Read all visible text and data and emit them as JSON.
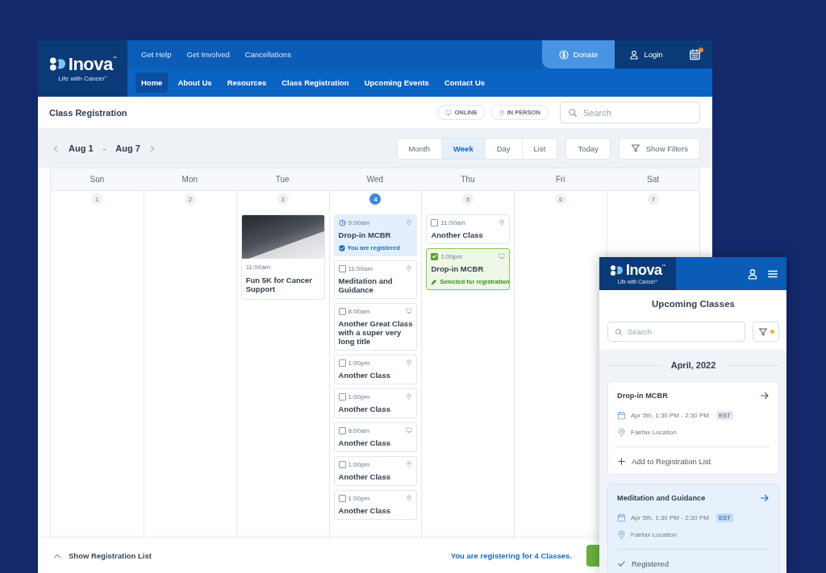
{
  "header": {
    "logo": {
      "wordmark": "Inova$^{™}$",
      "tagline": "Life with Cancer$^{®}$"
    },
    "utility_links": [
      "Get Help",
      "Get Involved",
      "Cancellations"
    ],
    "donate": "Donate",
    "login": "Login",
    "calendar_notification": true
  },
  "nav": [
    {
      "label": "Home",
      "selected": true
    },
    {
      "label": "About Us",
      "selected": false
    },
    {
      "label": "Resources",
      "selected": false
    },
    {
      "label": "Class Registration",
      "selected": false
    },
    {
      "label": "Upcoming Events",
      "selected": false
    },
    {
      "label": "Contact Us",
      "selected": false
    }
  ],
  "page_header": {
    "title": "Class Registration",
    "chips": [
      {
        "label": "ONLINE",
        "kind": "online"
      },
      {
        "label": "IN PERSON",
        "kind": "in_person"
      }
    ],
    "search": {
      "placeholder": "Search"
    }
  },
  "toolbar": {
    "range_start": "Aug 1",
    "separator": "-",
    "range_end": "Aug 7",
    "views": [
      {
        "label": "Month",
        "selected": false
      },
      {
        "label": "Week",
        "selected": true
      },
      {
        "label": "Day",
        "selected": false
      },
      {
        "label": "List",
        "selected": false
      }
    ],
    "today": "Today",
    "filters": "Show Filters"
  },
  "calendar": {
    "days": [
      {
        "name": "Sun",
        "date": "1",
        "selected": false
      },
      {
        "name": "Mon",
        "date": "2",
        "selected": false
      },
      {
        "name": "Tue",
        "date": "3",
        "selected": false,
        "events": [
          {
            "kind": "featured",
            "time": "11:00am",
            "title": "Fun 5K for Cancer Support"
          }
        ]
      },
      {
        "name": "Wed",
        "date": "4",
        "selected": true,
        "events": [
          {
            "kind": "in_person",
            "registered": true,
            "time": "9:00am",
            "title": "Drop-in MCBR",
            "note": "You are registered"
          },
          {
            "kind": "in_person",
            "registered": false,
            "checked": false,
            "time": "11:00am",
            "title": "Meditation and Guidance"
          },
          {
            "kind": "online",
            "registered": false,
            "checked": false,
            "time": "8:00am",
            "title": "Another Great Class with a super very long title"
          },
          {
            "kind": "in_person",
            "registered": false,
            "checked": false,
            "time": "1:00pm",
            "title": "Another Class"
          },
          {
            "kind": "in_person",
            "registered": false,
            "checked": false,
            "time": "1:00pm",
            "title": "Another Class"
          },
          {
            "kind": "online",
            "registered": false,
            "checked": false,
            "time": "8:00am",
            "title": "Another Class"
          },
          {
            "kind": "in_person",
            "registered": false,
            "checked": false,
            "time": "1:00pm",
            "title": "Another Class"
          },
          {
            "kind": "in_person",
            "registered": false,
            "checked": false,
            "time": "1:00pm",
            "title": "Another Class"
          }
        ]
      },
      {
        "name": "Thu",
        "date": "5",
        "selected": false,
        "events": [
          {
            "kind": "in_person",
            "registered": false,
            "checked": false,
            "time": "11:00am",
            "title": "Another Class"
          },
          {
            "kind": "online",
            "registered": false,
            "checked": true,
            "time": "1:00pm",
            "title": "Drop-in MCBR",
            "note": "Selected for registration"
          }
        ]
      },
      {
        "name": "Fri",
        "date": "6",
        "selected": false
      },
      {
        "name": "Sat",
        "date": "7",
        "selected": false
      }
    ]
  },
  "bottom_bar": {
    "toggle": "Show Registration List",
    "summary": "You are registering for 4 Classes."
  },
  "mobile": {
    "logo": {
      "wordmark": "Inova$^{™}$",
      "tagline": "Life with Cancer$^{®}$"
    },
    "title": "Upcoming Classes",
    "search": {
      "placeholder": "Search"
    },
    "filters_applied": true,
    "month": "April, 2022",
    "classes": [
      {
        "title": "Drop-in MCBR",
        "when": "Apr 5th, 1:30 PM - 2:30 PM",
        "timezone": "EST",
        "location": "Fairfax Location",
        "action": "Add to Registration List",
        "registered": false
      },
      {
        "title": "Meditation and Guidance",
        "when": "Apr 5th, 1:30 PM - 2:30 PM",
        "timezone": "EST",
        "location": "Fairfax Location",
        "action": "Registered",
        "registered": true
      }
    ]
  }
}
